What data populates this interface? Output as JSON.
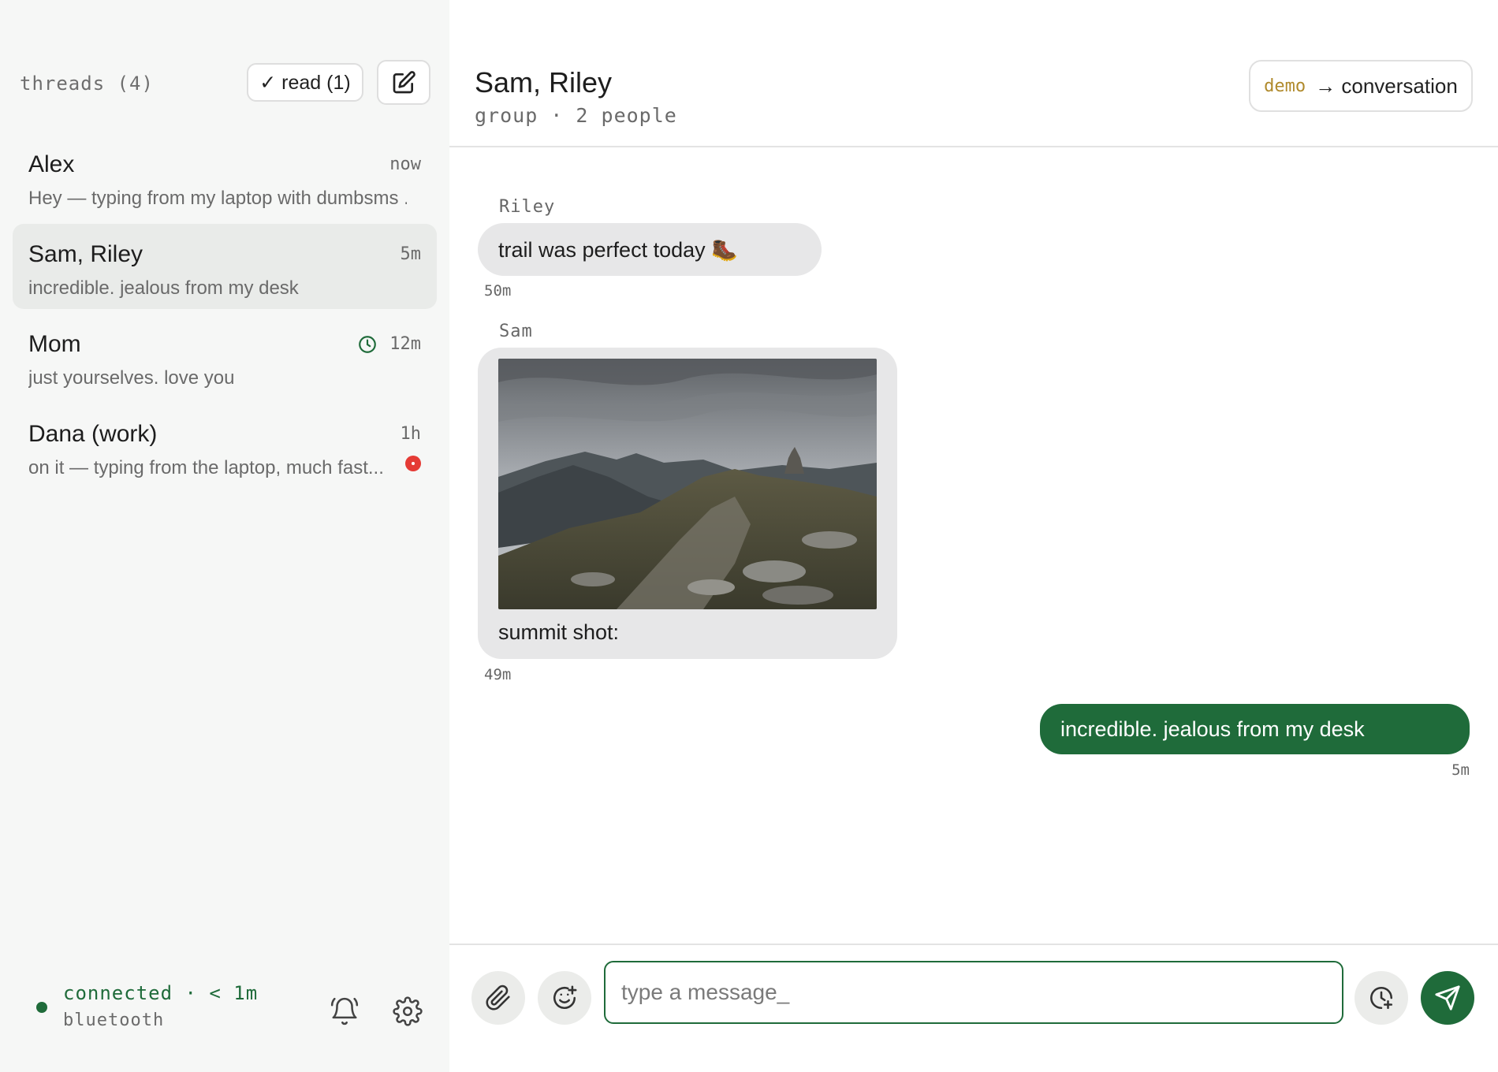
{
  "sidebar": {
    "threads_label": "threads (4)",
    "read_label": "✓ read (1)",
    "threads": [
      {
        "name": "Alex",
        "time": "now",
        "preview": "Hey — typing from my laptop with dumbsms ..."
      },
      {
        "name": "Sam, Riley",
        "time": "5m",
        "preview": "incredible. jealous from my desk"
      },
      {
        "name": "Mom",
        "time": "12m",
        "preview": "just yourselves. love you"
      },
      {
        "name": "Dana (work)",
        "time": "1h",
        "preview": "on it — typing from the laptop, much fast..."
      }
    ],
    "footer": {
      "connection": "connected · < 1m",
      "transport": "bluetooth"
    }
  },
  "conversation": {
    "title": "Sam, Riley",
    "subtitle": "group · 2 people",
    "demo_tag": "demo",
    "demo_label": "→ conversation",
    "messages": [
      {
        "sender": "Riley",
        "text": "trail was perfect today 🥾",
        "time": "50m"
      },
      {
        "sender": "Sam",
        "text": "summit shot:",
        "time": "49m"
      },
      {
        "text": "incredible. jealous from my desk",
        "time": "5m"
      }
    ]
  },
  "composer": {
    "placeholder": "type a message_"
  },
  "colors": {
    "accent": "#1f6b3a",
    "unread": "#e53b35",
    "demo_tag": "#b08a2c"
  }
}
